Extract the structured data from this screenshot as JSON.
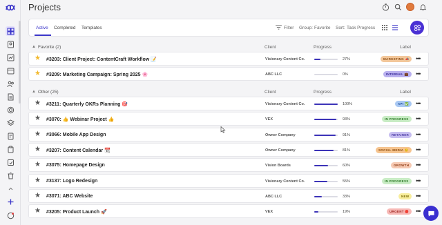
{
  "page": {
    "title": "Projects"
  },
  "tabs": [
    {
      "label": "Active",
      "active": true
    },
    {
      "label": "Completed",
      "active": false
    },
    {
      "label": "Templates",
      "active": false
    }
  ],
  "toolbar": {
    "filter_label": "Filter",
    "group_label": "Group:",
    "group_value": "Favorite",
    "sort_label": "Sort:",
    "sort_value": "Task Progress"
  },
  "columns": {
    "client": "Client",
    "progress": "Progress",
    "label": "Label"
  },
  "groups": [
    {
      "name": "Favorite (2)",
      "rows": [
        {
          "name": "#3203: Client Project: ContentCraft Workflow 📝",
          "client": "Visionary Content Co.",
          "progress": 27,
          "label": "MARKETING 📣",
          "label_bg": "#f3c79a",
          "label_fg": "#8a4b12",
          "favorite": true
        },
        {
          "name": "#3209: Marketing Campaign: Spring 2025 🌸",
          "client": "ABC LLC",
          "progress": 0,
          "label": "INTERNAL 💼",
          "label_bg": "#b9b0ef",
          "label_fg": "#3c2f9a",
          "favorite": true
        }
      ]
    },
    {
      "name": "Other (25)",
      "rows": [
        {
          "name": "#3211: Quarterly OKRs Planning 🎯",
          "client": "Visionary Content Co.",
          "progress": 100,
          "label": "API ✅",
          "label_bg": "#a9c8f3",
          "label_fg": "#1d4f99",
          "favorite": false
        },
        {
          "name": "#3070: 👍 Webinar Project 👍",
          "client": "VEX",
          "progress": 93,
          "label": "IN PROGRESS",
          "label_bg": "#c8ecc4",
          "label_fg": "#2d7a27",
          "favorite": false
        },
        {
          "name": "#3066: Mobile App Design",
          "client": "Owner Company",
          "progress": 91,
          "label": "RETAINER",
          "label_bg": "#c6bdf0",
          "label_fg": "#4a3aa3",
          "favorite": false
        },
        {
          "name": "#3207: Content Calendar 📆",
          "client": "Owner Company",
          "progress": 81,
          "label": "SOCIAL MEDIA 😊",
          "label_bg": "#f6c48f",
          "label_fg": "#8a4a0c",
          "favorite": false
        },
        {
          "name": "#3075: Homepage Design",
          "client": "Vision Boards",
          "progress": 60,
          "label": "GROWTH",
          "label_bg": "#f6c9b2",
          "label_fg": "#8f3d17",
          "favorite": false
        },
        {
          "name": "#3137: Logo Redesign",
          "client": "Visionary Content Co.",
          "progress": 55,
          "label": "IN PROGRESS",
          "label_bg": "#c8ecc4",
          "label_fg": "#2d7a27",
          "favorite": false
        },
        {
          "name": "#3071: ABC Website",
          "client": "ABC LLC",
          "progress": 33,
          "label": "NEW",
          "label_bg": "#f8ee9c",
          "label_fg": "#7a6a06",
          "favorite": false
        },
        {
          "name": "#3205: Product Launch 🚀",
          "client": "VEX",
          "progress": 19,
          "label": "URGENT 🔴",
          "label_bg": "#f7b9b6",
          "label_fg": "#9b1f1a",
          "favorite": false
        }
      ]
    }
  ]
}
